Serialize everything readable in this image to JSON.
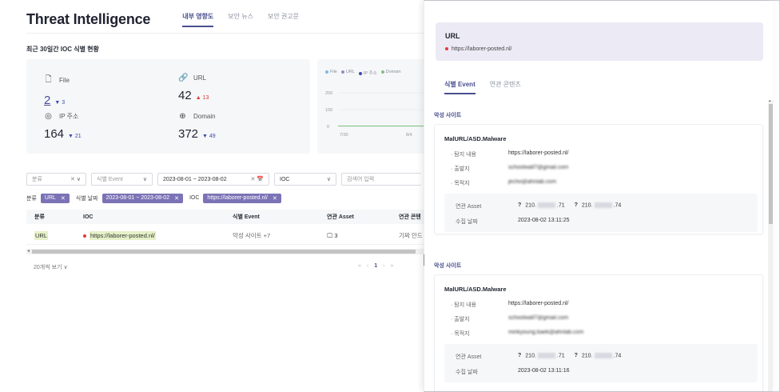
{
  "app_title": "Threat Intelligence",
  "tabs": [
    "내부 영향도",
    "보안 뉴스",
    "보안 권고문"
  ],
  "section_title": "최근 30일간 IOC 식별 현황",
  "stats": [
    {
      "label": "File",
      "icon": "file-icon",
      "value": "2",
      "delta": "3",
      "dir": "down"
    },
    {
      "label": "URL",
      "icon": "link-icon",
      "value": "42",
      "delta": "13",
      "dir": "up"
    },
    {
      "label": "IP 주소",
      "icon": "location-icon",
      "value": "164",
      "delta": "21",
      "dir": "down"
    },
    {
      "label": "Domain",
      "icon": "globe-icon",
      "value": "372",
      "delta": "49",
      "dir": "down"
    }
  ],
  "chart_data": {
    "type": "line",
    "legend": [
      {
        "name": "File",
        "color": "#7fb9e6"
      },
      {
        "name": "URL",
        "color": "#8a8fc6"
      },
      {
        "name": "IP 주소",
        "color": "#3b4aa8"
      },
      {
        "name": "Domain",
        "color": "#7bc47f"
      }
    ],
    "y_ticks": [
      "200",
      "100",
      "0"
    ],
    "x_ticks": [
      "7/30",
      "8/4"
    ],
    "ylim": [
      0,
      200
    ]
  },
  "filters": {
    "category": "분류",
    "event": "식별 Event",
    "date_range": "2023-08-01 ~ 2023-08-02",
    "ioc": "IOC",
    "search_placeholder": "검색어 입력"
  },
  "chips": {
    "category_label": "분류",
    "category_value": "URL",
    "date_label": "식별 날짜",
    "date_value": "2023-08-01 ~ 2023-08-02",
    "ioc_label": "IOC",
    "ioc_value": "https://laborer-posted.nl/"
  },
  "table": {
    "headers": [
      "분류",
      "IOC",
      "식별 Event",
      "연관 Asset",
      "연관 콘텐"
    ],
    "rows": [
      {
        "category": "URL",
        "ioc": "https://laborer-posted.nl/",
        "event": "악성 사이트 +7",
        "asset": "3",
        "content": "기짜 안드"
      }
    ]
  },
  "pager": {
    "page_size": "20개씩 보기",
    "current": "1",
    "first": "«",
    "prev": "‹",
    "next": "›",
    "last": "»"
  },
  "drawer": {
    "title": "URL",
    "url": "https://laborer-posted.nl/",
    "tabs": [
      "식별 Event",
      "연관 콘텐츠"
    ],
    "events": [
      {
        "section": "악성 사이트",
        "name": "MalURL/ASD.Malware",
        "detect_label": "· 탐지 내용",
        "detect_value": "https://laborer-posted.nl/",
        "from_label": "· 출발지",
        "from_value": "schoolwall7@gmail.com",
        "to_label": "· 목적지",
        "to_value": "jecho@ahnlab.com",
        "asset_label": "연관 Asset",
        "asset_ip1_a": "210.",
        "asset_ip1_b": ".71",
        "asset_ip2_a": "210.",
        "asset_ip2_b": ".74",
        "date_label": "수집 날짜",
        "date_value": "2023-08-02 13:11:25"
      },
      {
        "section": "악성 사이트",
        "name": "MalURL/ASD.Malware",
        "detect_label": "· 탐지 내용",
        "detect_value": "https://laborer-posted.nl/",
        "from_label": "· 출발지",
        "from_value": "schoolwall7@gmail.com",
        "to_label": "· 목적지",
        "to_value": "minkyoung.baek@ahnlab.com",
        "asset_label": "연관 Asset",
        "asset_ip1_a": "210.",
        "asset_ip1_b": ".71",
        "asset_ip2_a": "210.",
        "asset_ip2_b": ".74",
        "date_label": "수집 날짜",
        "date_value": "2023-08-02 13:11:16"
      }
    ]
  }
}
